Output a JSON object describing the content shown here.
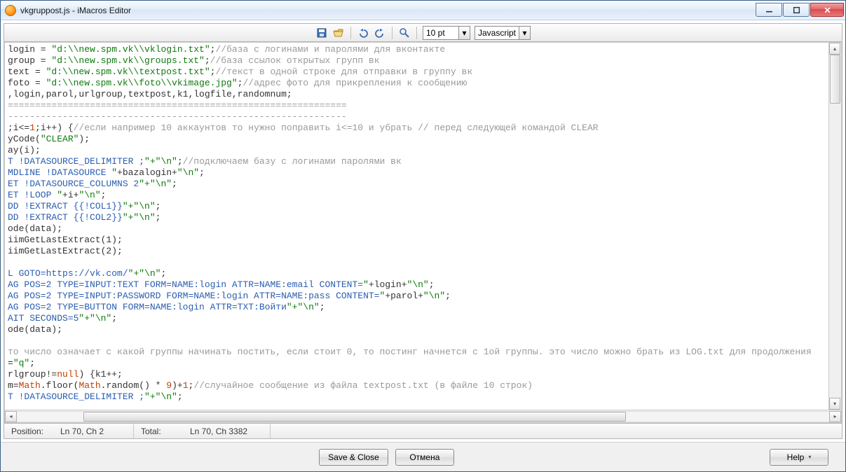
{
  "window": {
    "title": "vkgruppost.js - iMacros Editor"
  },
  "toolbar": {
    "font_size": "10 pt",
    "language": "Javascript"
  },
  "status": {
    "position_label": "Position:",
    "position_value": "Ln 70, Ch 2",
    "total_label": "Total:",
    "total_value": "Ln 70, Ch 3382"
  },
  "footer": {
    "save_close": "Save & Close",
    "cancel": "Отмена",
    "help": "Help"
  },
  "code": {
    "l01a": "login = ",
    "l01s": "\"d:\\\\new.spm.vk\\\\vklogin.txt\"",
    "l01b": ";",
    "l01c": "//база с логинами и паролями для вконтакте",
    "l02a": "group = ",
    "l02s": "\"d:\\\\new.spm.vk\\\\groups.txt\"",
    "l02b": ";",
    "l02c": "//база ссылок открытых групп вк",
    "l03a": "text = ",
    "l03s": "\"d:\\\\new.spm.vk\\\\textpost.txt\"",
    "l03b": ";",
    "l03c": "//текст в одной строке для отправки в группу вк",
    "l04a": "foto = ",
    "l04s": "\"d:\\\\new.spm.vk\\\\foto\\\\vkimage.jpg\"",
    "l04b": ";",
    "l04c": "//адрес фото для прикрепления к сообщению",
    "l05": ",login,parol,urlgroup,textpost,k1,logfile,randomnum;",
    "l06": "==============================================================",
    "l07": "--------------------------------------------------------------",
    "l08a": ";i<=",
    "l08n1": "1",
    "l08b": ";i++) {",
    "l08c": "//если например 10 аккаунтов то нужно поправить i<=10 и убрать // перед следующей командой CLEAR",
    "l09a": "yCode(",
    "l09s": "\"CLEAR\"",
    "l09b": ");",
    "l10": "ay(i);",
    "l11a": "T !DATASOURCE_DELIMITER ;",
    "l11s": "\"+\"\\n\"",
    "l11b": ";",
    "l11c": "//подключаем базу с логинами паролями вк",
    "l12a": "MDLINE !DATASOURCE ",
    "l12s1": "\"",
    "l12v": "+bazalogin+",
    "l12s2": "\"\\n\"",
    "l12b": ";",
    "l13a": "ET !DATASOURCE_COLUMNS 2",
    "l13s": "\"+\"\\n\"",
    "l13b": ";",
    "l14a": "ET !LOOP ",
    "l14s1": "\"",
    "l14v": "+i+",
    "l14s2": "\"\\n\"",
    "l14b": ";",
    "l15a": "DD !EXTRACT {{!COL1}}",
    "l15s": "\"+\"\\n\"",
    "l15b": ";",
    "l16a": "DD !EXTRACT {{!COL2}}",
    "l16s": "\"+\"\\n\"",
    "l16b": ";",
    "l17": "ode(data);",
    "l18": "iimGetLastExtract(1);",
    "l19": "iimGetLastExtract(2);",
    "l21a": "L GOTO=https://vk.com/",
    "l21s": "\"+\"\\n\"",
    "l21b": ";",
    "l22a": "AG POS=2 TYPE=INPUT:TEXT FORM=NAME:login ATTR=NAME:email CONTENT=",
    "l22s1": "\"",
    "l22v": "+login+",
    "l22s2": "\"\\n\"",
    "l22b": ";",
    "l23a": "AG POS=2 TYPE=INPUT:PASSWORD FORM=NAME:login ATTR=NAME:pass CONTENT=",
    "l23s1": "\"",
    "l23v": "+parol+",
    "l23s2": "\"\\n\"",
    "l23b": ";",
    "l24a": "AG POS=2 TYPE=BUTTON FORM=NAME:login ATTR=TXT:Войти",
    "l24s": "\"+\"\\n\"",
    "l24b": ";",
    "l25a": "AIT SECONDS=5",
    "l25s": "\"+\"\\n\"",
    "l25b": ";",
    "l26": "ode(data);",
    "l28c": "то число означает с какой группы начинать постить, если стоит 0, то постинг начнется с 1ой группы. это число можно брать из LOG.txt для продолжения",
    "l29a": "=",
    "l29s": "\"q\"",
    "l29b": ";",
    "l30a": "rlgroup!=",
    "l30n": "null",
    "l30b": ") {k1++;",
    "l31a": "m=",
    "l31m": "Math",
    "l31b": ".floor(",
    "l31m2": "Math",
    "l31c": ".random() * ",
    "l31n": "9",
    "l31d": ")+",
    "l31n2": "1",
    "l31e": ";",
    "l31cmt": "//случайное сообщение из файла textpost.txt (в файле 10 строк)",
    "l32a": "T !DATASOURCE_DELIMITER ;",
    "l32s": "\"+\"\\n\"",
    "l32b": ";"
  }
}
